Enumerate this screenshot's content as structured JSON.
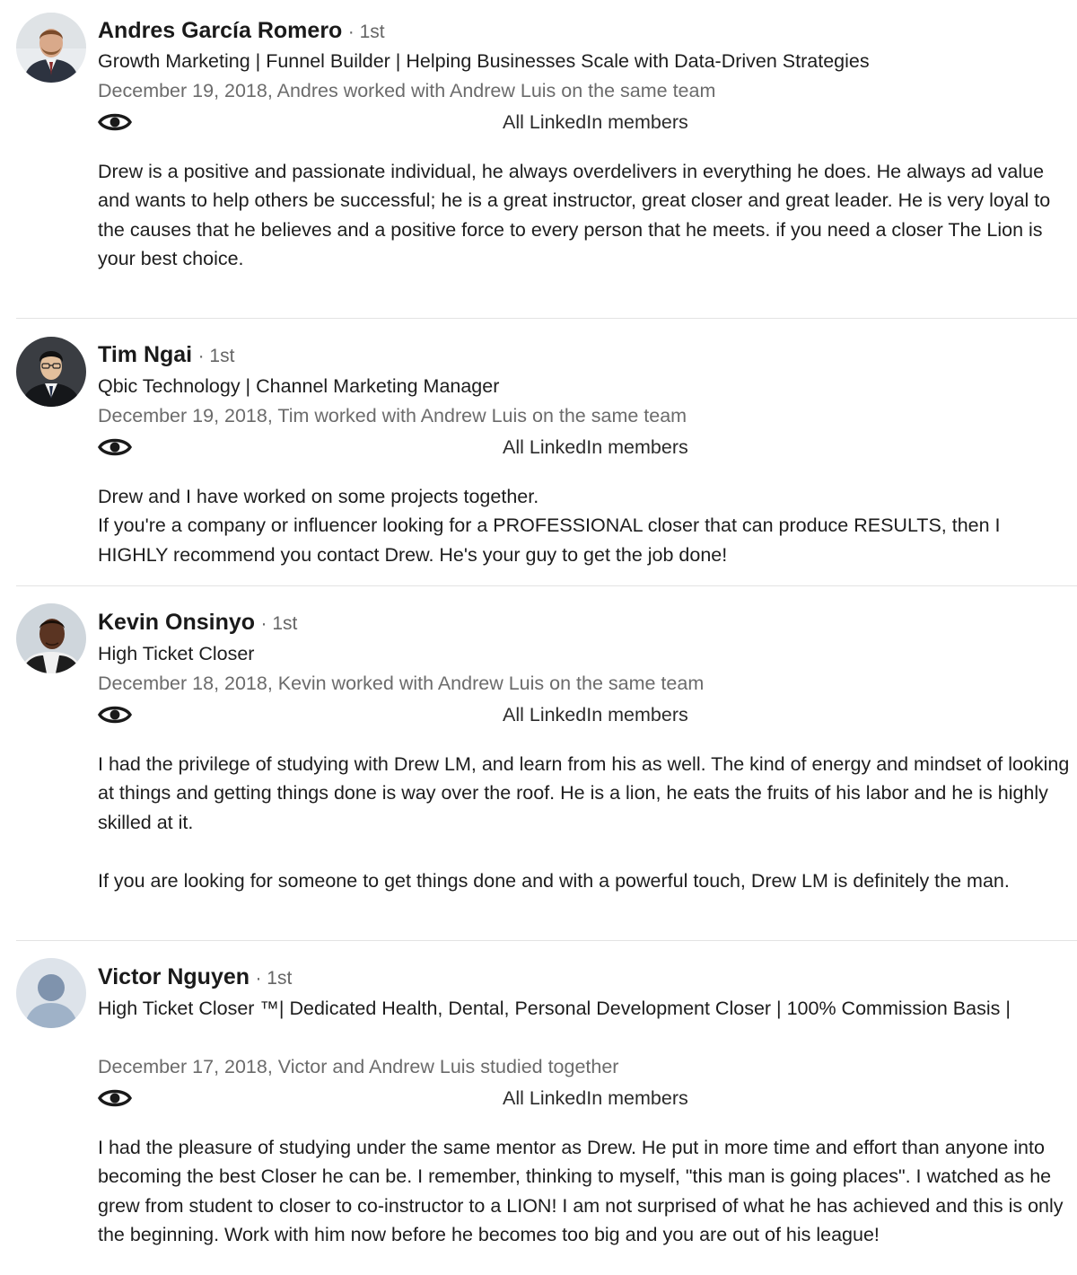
{
  "recommendations": [
    {
      "name": "Andres García Romero",
      "degree": "· 1st",
      "headline": "Growth Marketing | Funnel Builder | Helping Businesses Scale with Data-Driven Strategies",
      "meta": "December 19, 2018, Andres worked with Andrew Luis on the same team",
      "visibility": "All LinkedIn members",
      "visibility_icon": "eye-icon",
      "paragraphs": [
        "Drew is a positive and passionate individual, he always overdelivers in everything he does. He always ad value and wants to help others be successful; he is a great instructor, great closer and great leader. He is very loyal to the causes that he believes and a positive force to every person that he meets. if you need a closer The Lion is your best choice."
      ]
    },
    {
      "name": "Tim Ngai",
      "degree": "· 1st",
      "headline": "Qbic Technology | Channel Marketing Manager",
      "meta": "December 19, 2018, Tim worked with Andrew Luis on the same team",
      "visibility": "All LinkedIn members",
      "visibility_icon": "eye-icon",
      "paragraphs": [
        "Drew and I have worked on some projects together.",
        "If you're a company or influencer looking for a PROFESSIONAL closer that can produce RESULTS, then I HIGHLY recommend you contact Drew. He's your guy to get the job done!"
      ]
    },
    {
      "name": "Kevin Onsinyo",
      "degree": "· 1st",
      "headline": "High Ticket Closer",
      "meta": "December 18, 2018, Kevin worked with Andrew Luis on the same team",
      "visibility": "All LinkedIn members",
      "visibility_icon": "eye-icon",
      "paragraphs": [
        "I had the privilege of studying with Drew LM, and learn from his as well. The kind of energy and mindset of looking at things and getting things done is way over the roof. He is a lion, he eats the fruits of his labor and he is highly skilled at it.",
        "If you are looking for someone to get things done and with a powerful touch, Drew LM is definitely the man."
      ]
    },
    {
      "name": "Victor Nguyen",
      "degree": "· 1st",
      "headline": "High Ticket Closer ™| Dedicated Health, Dental, Personal Development Closer | 100% Commission Basis |",
      "meta": "December 17, 2018, Victor and Andrew Luis studied together",
      "visibility": "All LinkedIn members",
      "visibility_icon": "eye-icon",
      "paragraphs": [
        "I had the pleasure of studying under the same mentor as Drew. He put in more time and effort than anyone into becoming the best Closer he can be. I remember, thinking to myself, \"this man is going places\". I watched as he grew from student to closer to co-instructor to a LION! I am not surprised of what he has achieved and this is only the beginning. Work with him now before he becomes too big and you are out of his league!"
      ]
    }
  ]
}
